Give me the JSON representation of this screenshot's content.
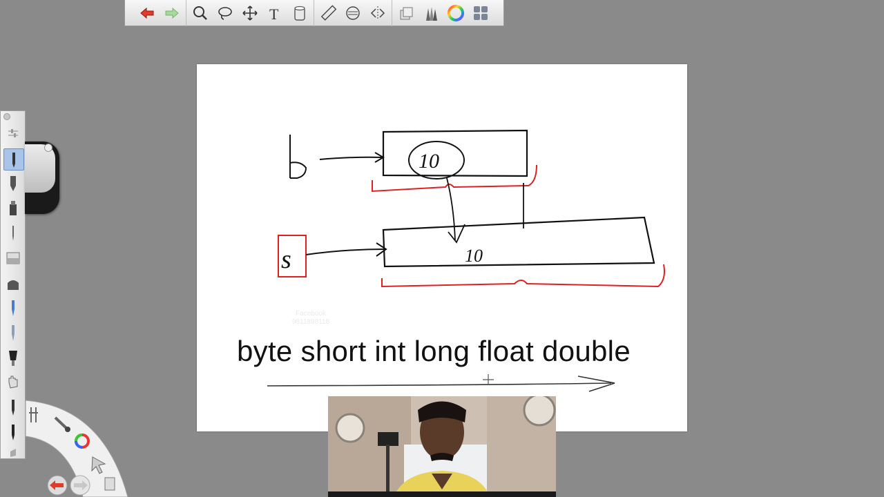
{
  "toolbar": {
    "items": [
      {
        "icon": "undo-icon"
      },
      {
        "icon": "redo-icon"
      },
      {
        "icon": "zoom-icon"
      },
      {
        "icon": "lasso-icon"
      },
      {
        "icon": "move-icon"
      },
      {
        "icon": "text-icon"
      },
      {
        "icon": "fill-icon"
      },
      {
        "icon": "ruler-icon"
      },
      {
        "icon": "ellipse-guide-icon"
      },
      {
        "icon": "symmetry-icon"
      },
      {
        "icon": "layers-icon"
      },
      {
        "icon": "brush-library-icon"
      },
      {
        "icon": "color-wheel-icon"
      },
      {
        "icon": "copic-library-icon"
      }
    ]
  },
  "canvas": {
    "types_text": "byte short int long float double",
    "handwriting": {
      "var_b": "b",
      "var_s": "s",
      "value_top": "10",
      "value_bottom": "10"
    },
    "watermark_line1": "Facebook",
    "watermark_line2": "9811898118"
  },
  "colors": {
    "background": "#8a8a8a",
    "ink": "#111111",
    "red_ink": "#e02020",
    "active_tool": "#a9c4e8"
  }
}
